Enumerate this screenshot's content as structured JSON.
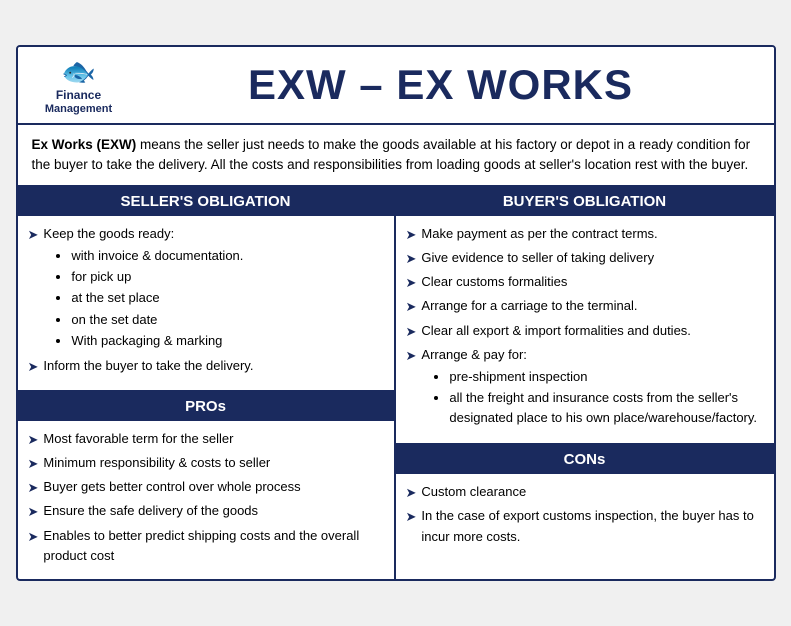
{
  "header": {
    "logo_icon": "🐟",
    "logo_line1": "Finance",
    "logo_line2": "Management",
    "main_title": "EXW – EX WORKS"
  },
  "description": {
    "bold_part": "Ex Works (EXW)",
    "text": " means the seller just needs to make the goods available at his factory or depot in a ready condition for the buyer to take the delivery. All the costs and responsibilities from loading goods at seller's location rest with the buyer."
  },
  "sellers_obligation": {
    "header": "SELLER'S OBLIGATION",
    "items": [
      {
        "type": "arrow",
        "text": "Keep the goods ready:",
        "bullets": [
          "with invoice & documentation.",
          "for pick up",
          "at the set place",
          "on the set date",
          "With packaging & marking"
        ]
      },
      {
        "type": "arrow",
        "text": "Inform the buyer to take the delivery.",
        "bullets": []
      }
    ]
  },
  "pros": {
    "header": "PROs",
    "items": [
      "Most favorable term for the seller",
      "Minimum responsibility & costs to seller",
      "Buyer gets  better control over whole process",
      "Ensure the safe delivery of the goods",
      "Enables to better predict shipping costs and the overall product cost"
    ]
  },
  "buyers_obligation": {
    "header": "BUYER'S OBLIGATION",
    "items": [
      {
        "type": "arrow",
        "text": "Make payment as per the contract terms.",
        "bullets": []
      },
      {
        "type": "arrow",
        "text": "Give evidence to seller of taking delivery",
        "bullets": []
      },
      {
        "type": "arrow",
        "text": "Clear customs formalities",
        "bullets": []
      },
      {
        "type": "arrow",
        "text": "Arrange for a carriage to the terminal.",
        "bullets": []
      },
      {
        "type": "arrow",
        "text": "Clear all export & import formalities and duties.",
        "bullets": []
      },
      {
        "type": "arrow",
        "text": "Arrange & pay for:",
        "bullets": [
          "pre-shipment inspection",
          "all the freight and insurance costs from the seller's designated place to his own place/warehouse/factory."
        ]
      }
    ]
  },
  "cons": {
    "header": "CONs",
    "items": [
      "Custom clearance",
      "In the case of export customs inspection, the buyer has to incur more costs."
    ]
  }
}
